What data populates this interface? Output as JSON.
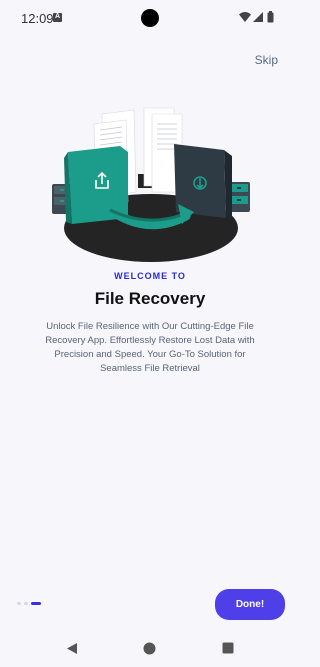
{
  "status_bar": {
    "time": "12:09",
    "notification_glyph": "A",
    "icons": [
      "wifi-icon",
      "signal-icon",
      "battery-icon"
    ]
  },
  "header": {
    "skip_label": "Skip"
  },
  "illustration": {
    "icon": "file-recovery-illustration",
    "colors": {
      "accent": "#1c9c8a",
      "dark": "#2f3b44",
      "platform": "#242424"
    }
  },
  "content": {
    "eyebrow": "WELCOME TO",
    "title": "File Recovery",
    "description": "Unlock File Resilience with Our Cutting-Edge File Recovery App. Effortlessly Restore Lost Data with Precision and Speed. Your Go-To Solution for Seamless File Retrieval"
  },
  "pager": {
    "total": 3,
    "current": 3
  },
  "actions": {
    "done_label": "Done!"
  },
  "nav_bar": {
    "icons": [
      "back-icon",
      "home-icon",
      "recents-icon"
    ]
  },
  "colors": {
    "background": "#f6f6fb",
    "primary": "#4f3fe8",
    "eyebrow": "#2a2ad0",
    "description": "#5a6478"
  }
}
